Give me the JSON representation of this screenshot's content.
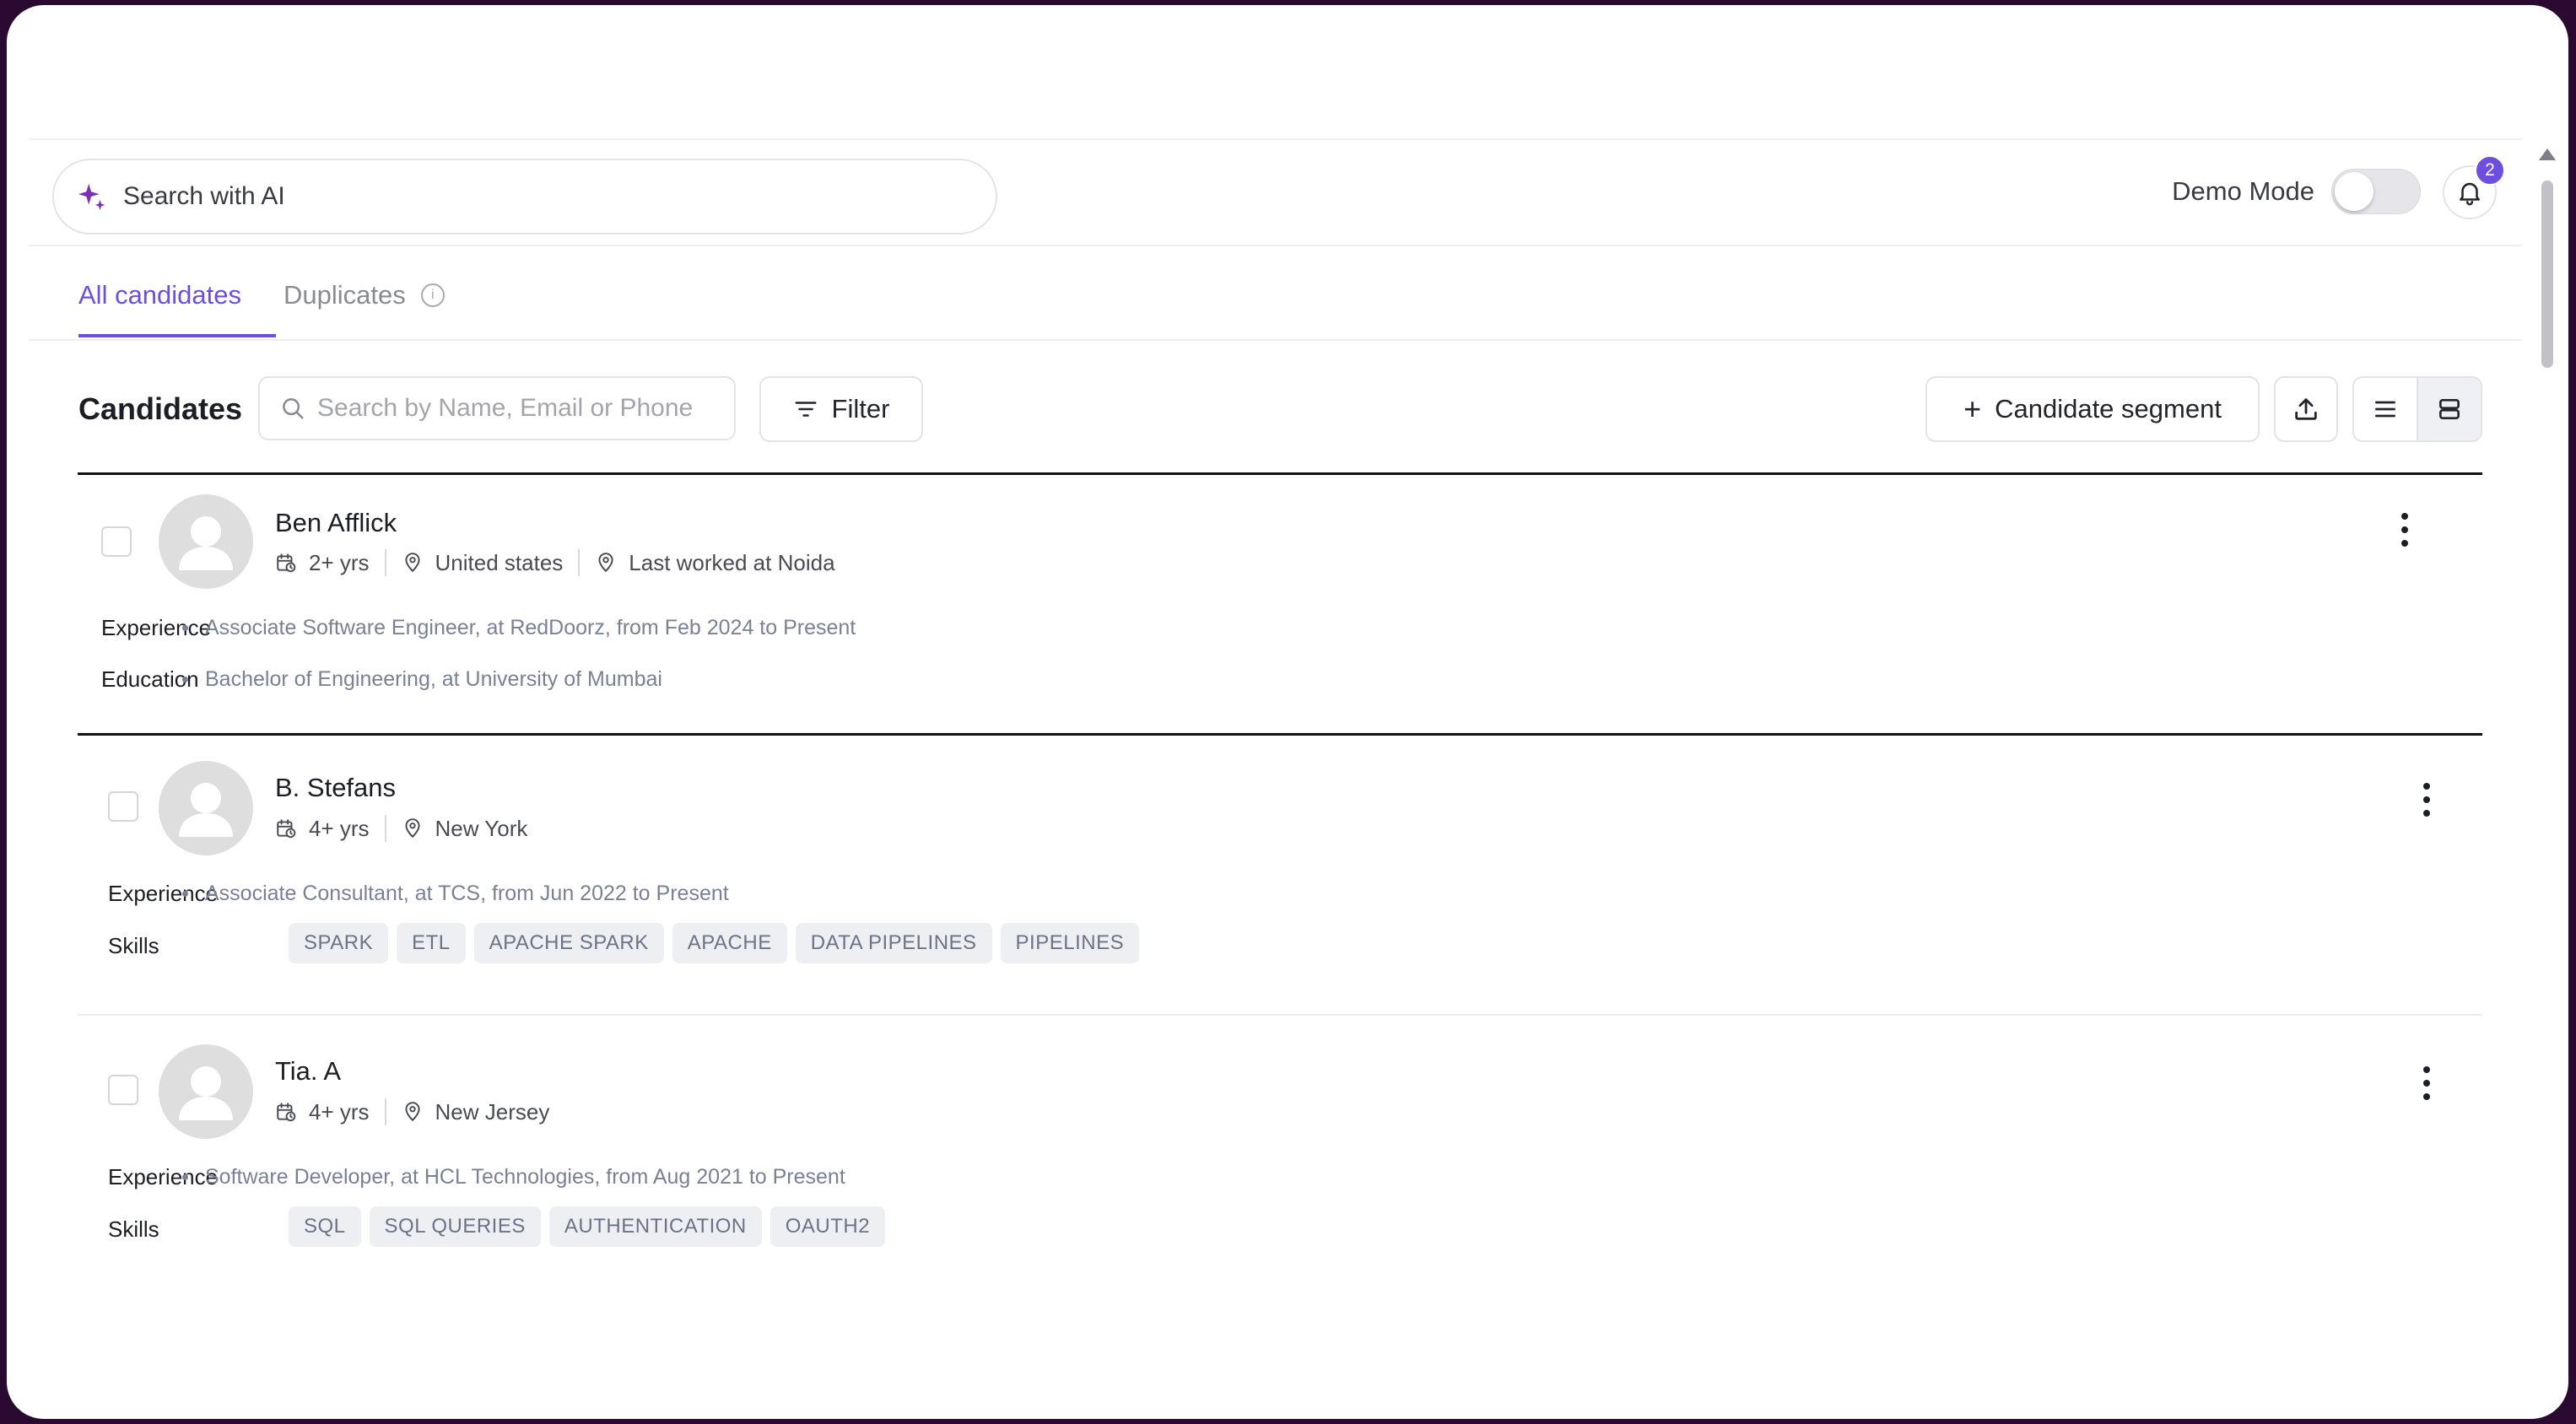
{
  "top": {
    "ai_search_placeholder": "Search with AI",
    "demo_mode_label": "Demo Mode",
    "demo_mode_on": false,
    "notification_count": "2"
  },
  "tabs": [
    {
      "label": "All candidates",
      "active": true
    },
    {
      "label": "Duplicates",
      "active": false
    }
  ],
  "toolbar": {
    "title": "Candidates",
    "search_placeholder": "Search by Name, Email or Phone",
    "filter_label": "Filter",
    "segment_label": "Candidate segment"
  },
  "candidates": [
    {
      "name": "Ben Afflick",
      "experience_years": "2+ yrs",
      "location": "United states",
      "last_worked": "Last worked at Noida",
      "experience_label": "Experience",
      "experience": "Associate Software Engineer, at RedDoorz, from Feb 2024 to Present",
      "education_label": "Education",
      "education": "Bachelor of Engineering, at University of Mumbai"
    },
    {
      "name": "B. Stefans",
      "experience_years": "4+ yrs",
      "location": "New York",
      "experience_label": "Experience",
      "experience": "Associate Consultant, at TCS, from Jun 2022 to Present",
      "skills_label": "Skills",
      "skills": [
        "SPARK",
        "ETL",
        "APACHE SPARK",
        "APACHE",
        "DATA PIPELINES",
        "PIPELINES"
      ]
    },
    {
      "name": "Tia. A",
      "experience_years": "4+ yrs",
      "location": "New Jersey",
      "experience_label": "Experience",
      "experience": "Software Developer, at HCL Technologies, from Aug 2021 to Present",
      "skills_label": "Skills",
      "skills": [
        "SQL",
        "SQL QUERIES",
        "AUTHENTICATION",
        "OAUTH2"
      ]
    }
  ],
  "colors": {
    "accent": "#6d4fe0",
    "muted_text": "#7a8196",
    "skill_bg": "#eeeff2"
  }
}
